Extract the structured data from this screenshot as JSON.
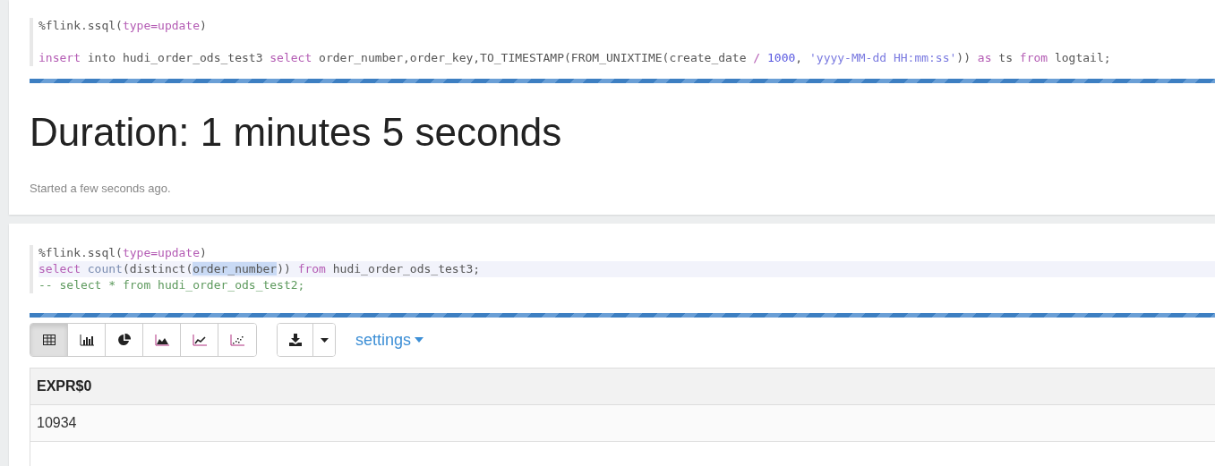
{
  "paragraphs": [
    {
      "code": [
        {
          "kind": "code",
          "active": false,
          "tokens": [
            {
              "t": "%flink.ssql(",
              "kind": "plain"
            },
            {
              "t": "type",
              "kind": "kw"
            },
            {
              "t": "=",
              "kind": "op"
            },
            {
              "t": "update",
              "kind": "kw"
            },
            {
              "t": ")",
              "kind": "plain"
            }
          ]
        },
        {
          "kind": "blank"
        },
        {
          "kind": "code",
          "active": false,
          "tokens": [
            {
              "t": "insert",
              "kind": "kw"
            },
            {
              "t": " into hudi_order_ods_test3 ",
              "kind": "plain"
            },
            {
              "t": "select",
              "kind": "kw"
            },
            {
              "t": " order_number,order_key,TO_TIMESTAMP(FROM_UNIXTIME(create_date ",
              "kind": "plain"
            },
            {
              "t": "/ ",
              "kind": "op"
            },
            {
              "t": "1000",
              "kind": "num"
            },
            {
              "t": ", ",
              "kind": "plain"
            },
            {
              "t": "'yyyy-MM-dd HH:mm:ss'",
              "kind": "str"
            },
            {
              "t": ")) ",
              "kind": "plain"
            },
            {
              "t": "as",
              "kind": "kw"
            },
            {
              "t": " ts ",
              "kind": "plain"
            },
            {
              "t": "from",
              "kind": "kw"
            },
            {
              "t": " logtail;",
              "kind": "plain"
            }
          ]
        }
      ],
      "progress": {
        "level": 1
      },
      "duration": "Duration: 1 minutes 5 seconds",
      "status": "Started a few seconds ago."
    },
    {
      "code": [
        {
          "kind": "code",
          "active": false,
          "tokens": [
            {
              "t": "%flink.ssql(",
              "kind": "plain"
            },
            {
              "t": "type",
              "kind": "kw"
            },
            {
              "t": "=",
              "kind": "op"
            },
            {
              "t": "update",
              "kind": "kw"
            },
            {
              "t": ")",
              "kind": "plain"
            }
          ]
        },
        {
          "kind": "code",
          "active": true,
          "tokens": [
            {
              "t": "select ",
              "kind": "kw"
            },
            {
              "t": "count",
              "kind": "fn"
            },
            {
              "t": "(distinct(",
              "kind": "plain"
            },
            {
              "t": "order_number",
              "kind": "plain",
              "selected": true
            },
            {
              "t": ")) ",
              "kind": "plain"
            },
            {
              "t": "from",
              "kind": "kw"
            },
            {
              "t": " hudi_order_ods_test3;",
              "kind": "plain"
            }
          ]
        },
        {
          "kind": "code",
          "active": false,
          "tokens": [
            {
              "t": "-- select * from hudi_order_ods_test2;",
              "kind": "comment"
            }
          ]
        }
      ],
      "progress": {
        "level": 1
      },
      "toolbar": [
        {
          "kind": "table",
          "selected": true
        },
        {
          "kind": "bar",
          "selected": false
        },
        {
          "kind": "pie",
          "selected": false
        },
        {
          "kind": "area",
          "selected": false
        },
        {
          "kind": "line",
          "selected": false
        },
        {
          "kind": "scatter",
          "selected": false
        }
      ],
      "settings": "settings",
      "table": {
        "columns": [
          "EXPR$0"
        ],
        "rows": [
          [
            "10934"
          ]
        ]
      }
    }
  ]
}
